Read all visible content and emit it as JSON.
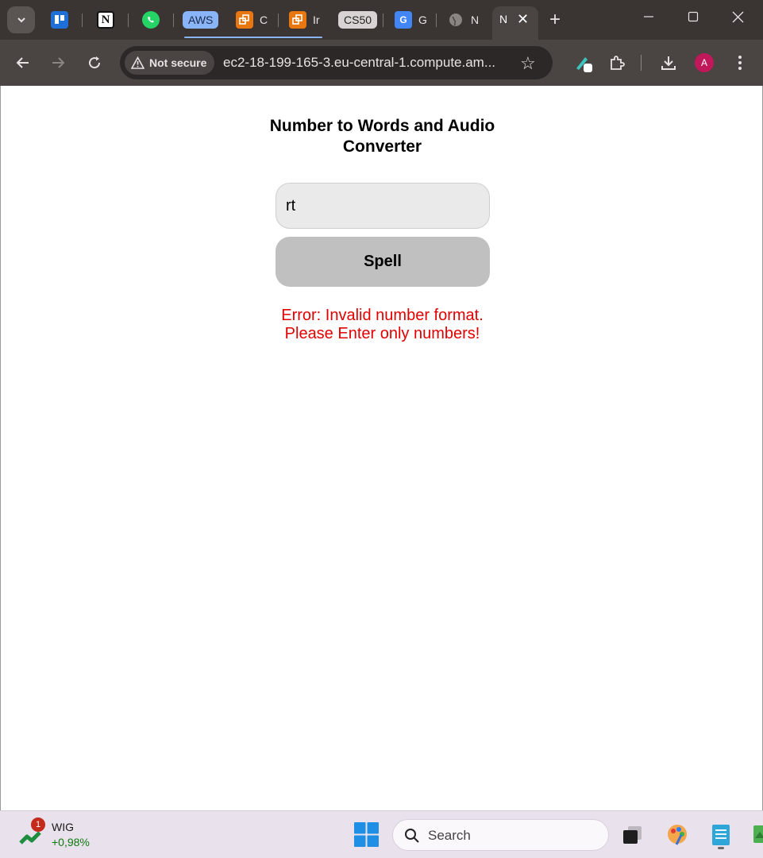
{
  "browser": {
    "tabs": [
      {
        "label": "",
        "icon": "trello-icon"
      },
      {
        "label": "",
        "icon": "notion-icon"
      },
      {
        "label": "",
        "icon": "whatsapp-icon"
      },
      {
        "label": "AWS",
        "icon": "aws-pill"
      },
      {
        "label": "C",
        "icon": "aws-service-icon"
      },
      {
        "label": "Ir",
        "icon": "aws-service-icon"
      },
      {
        "label": "CS50",
        "icon": "cs50-pill"
      },
      {
        "label": "G",
        "icon": "google-translate-icon"
      },
      {
        "label": "N",
        "icon": "globe-icon"
      }
    ],
    "active_tab": {
      "label": "N",
      "close": "✕"
    },
    "new_tab": "+",
    "address_bar": {
      "security_label": "Not secure",
      "url": "ec2-18-199-165-3.eu-central-1.compute.am..."
    },
    "profile_initial": "A",
    "colors": {
      "aws_pill": "#8ab4f8",
      "cs50_pill": "#d9d4d3",
      "accent": "#8ab4f8"
    }
  },
  "page": {
    "title": "Number to Words and Audio Converter",
    "number_input": {
      "value": "rt"
    },
    "spell_button": "Spell",
    "error_line1": "Error: Invalid number format.",
    "error_line2": "Please Enter only numbers!",
    "colors": {
      "error": "#e00000",
      "button": "#c0c0c0"
    }
  },
  "taskbar": {
    "widget": {
      "name": "WIG",
      "change": "+0,98%",
      "badge": "1"
    },
    "search_label": "Search"
  }
}
